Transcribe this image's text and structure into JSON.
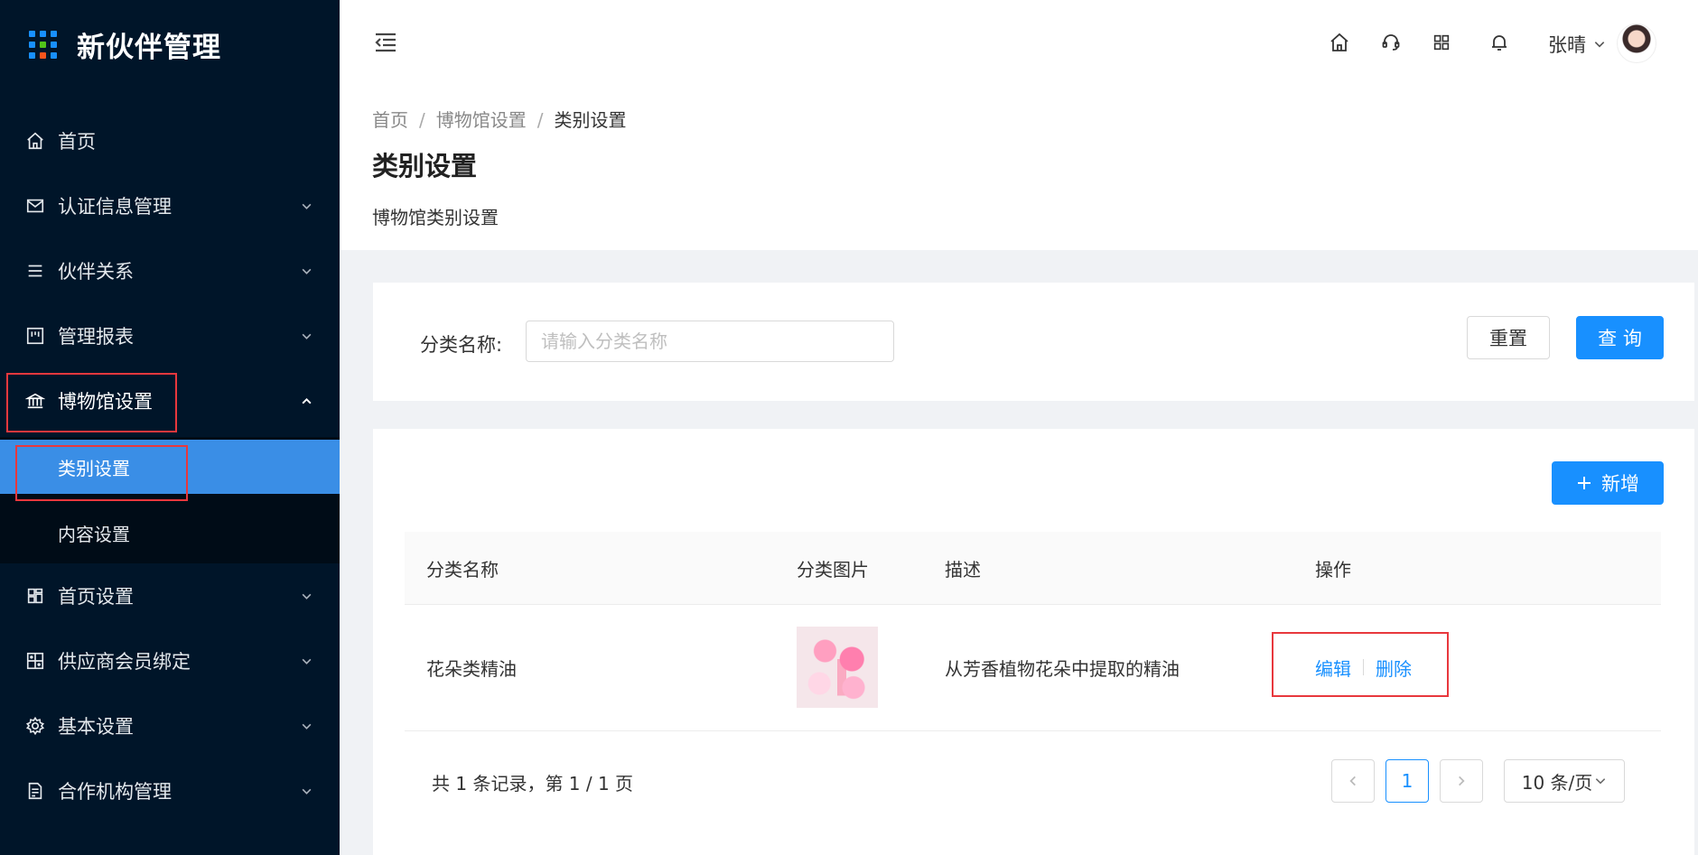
{
  "brand": {
    "title": "新伙伴管理"
  },
  "sidebar": {
    "items": [
      {
        "label": "首页",
        "icon": "home-icon"
      },
      {
        "label": "认证信息管理",
        "icon": "mail-icon"
      },
      {
        "label": "伙伴关系",
        "icon": "list-icon"
      },
      {
        "label": "管理报表",
        "icon": "report-icon"
      },
      {
        "label": "博物馆设置",
        "icon": "bank-icon"
      },
      {
        "label": "首页设置",
        "icon": "layout-icon"
      },
      {
        "label": "供应商会员绑定",
        "icon": "grid-icon"
      },
      {
        "label": "基本设置",
        "icon": "gear-icon"
      },
      {
        "label": "合作机构管理",
        "icon": "doc-icon"
      }
    ],
    "subitems": [
      {
        "label": "类别设置",
        "active": true
      },
      {
        "label": "内容设置",
        "active": false
      }
    ]
  },
  "header": {
    "user_name": "张晴",
    "icons": [
      "menu-fold-icon",
      "home-icon",
      "headset-icon",
      "apps-icon",
      "bell-icon"
    ]
  },
  "breadcrumb": {
    "items": [
      "首页",
      "博物馆设置",
      "类别设置"
    ],
    "separator": "/"
  },
  "page": {
    "title": "类别设置",
    "subtitle": "博物馆类别设置"
  },
  "search": {
    "label": "分类名称:",
    "placeholder": "请输入分类名称",
    "reset_label": "重置",
    "query_label": "查 询"
  },
  "table": {
    "add_label": "新增",
    "columns": [
      "分类名称",
      "分类图片",
      "描述",
      "操作"
    ],
    "rows": [
      {
        "name": "花朵类精油",
        "description": "从芳香植物花朵中提取的精油",
        "edit_label": "编辑",
        "delete_label": "删除"
      }
    ]
  },
  "pagination": {
    "total_text": "共 1 条记录，第 1 / 1 页",
    "current_page": "1",
    "page_size": "10 条/页"
  },
  "colors": {
    "sidebar_bg": "#001529",
    "primary": "#1890ff",
    "active_menu": "#3a8ee6",
    "highlight_box": "#e8383d"
  }
}
